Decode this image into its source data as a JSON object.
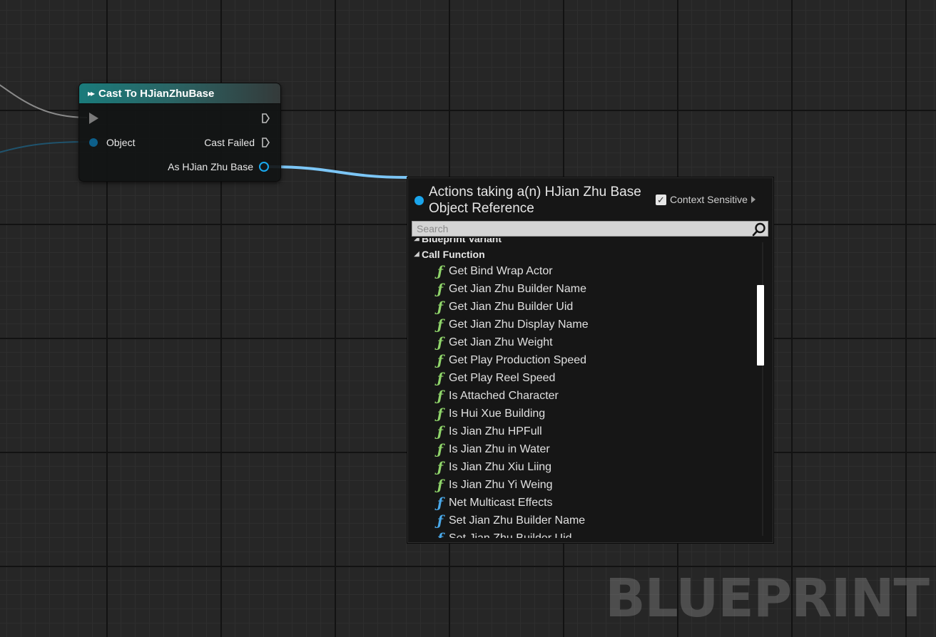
{
  "graph": {
    "watermark": "BLUEPRINT"
  },
  "node": {
    "title": "Cast To HJianZhuBase",
    "pins": {
      "object": "Object",
      "cast_failed": "Cast Failed",
      "as_output": "As HJian Zhu Base"
    },
    "colors": {
      "header": "#1a7b7b",
      "object_pin": "#19a9ef",
      "exec_pin": "#7a7a7a"
    }
  },
  "menu": {
    "title_line1": "Actions taking a(n) HJian Zhu Base",
    "title_line2": "Object Reference",
    "context_sensitive_label": "Context Sensitive",
    "context_sensitive_checked": true,
    "search_placeholder": "Search",
    "categories": [
      {
        "label": "Blueprint Variant"
      },
      {
        "label": "Call Function"
      }
    ],
    "items": [
      {
        "label": "Get Bind Wrap Actor",
        "icon": "function-pure-icon"
      },
      {
        "label": "Get Jian Zhu Builder Name",
        "icon": "function-pure-icon"
      },
      {
        "label": "Get Jian Zhu Builder Uid",
        "icon": "function-pure-icon"
      },
      {
        "label": "Get Jian Zhu Display Name",
        "icon": "function-pure-icon"
      },
      {
        "label": "Get Jian Zhu Weight",
        "icon": "function-pure-icon"
      },
      {
        "label": "Get Play Production Speed",
        "icon": "function-pure-icon"
      },
      {
        "label": "Get Play Reel Speed",
        "icon": "function-pure-icon"
      },
      {
        "label": "Is Attached Character",
        "icon": "function-pure-icon"
      },
      {
        "label": "Is Hui Xue Building",
        "icon": "function-pure-icon"
      },
      {
        "label": "Is Jian Zhu HPFull",
        "icon": "function-pure-icon"
      },
      {
        "label": "Is Jian Zhu in Water",
        "icon": "function-pure-icon"
      },
      {
        "label": "Is Jian Zhu Xiu Liing",
        "icon": "function-pure-icon"
      },
      {
        "label": "Is Jian Zhu Yi Weing",
        "icon": "function-pure-icon"
      },
      {
        "label": "Net Multicast Effects",
        "icon": "function-impure-icon"
      },
      {
        "label": "Set Jian Zhu Builder Name",
        "icon": "function-impure-icon"
      },
      {
        "label": "Set Jian Zhu Builder Uid",
        "icon": "function-impure-icon"
      }
    ],
    "colors": {
      "pure_function": "#8fd46a",
      "impure_function": "#4aa8e8",
      "title_dot": "#1aa5ec"
    }
  }
}
